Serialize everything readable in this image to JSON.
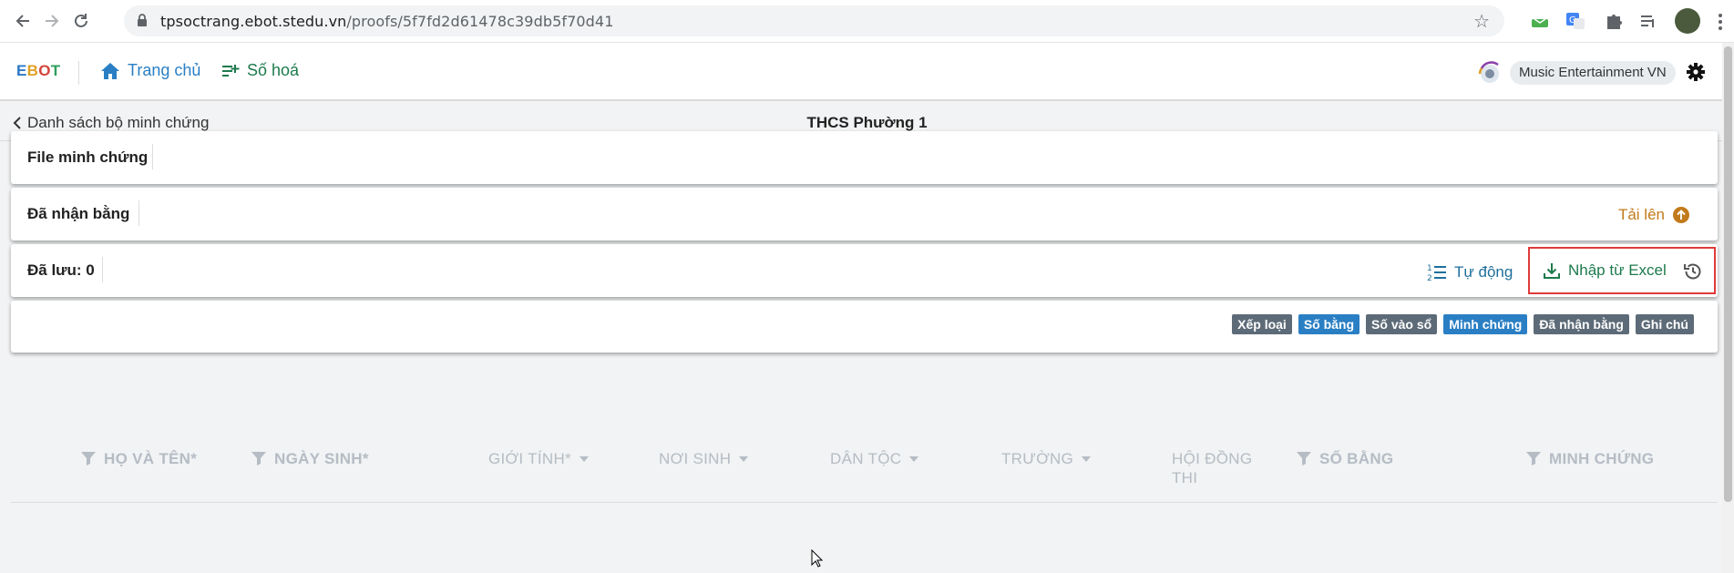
{
  "browser": {
    "url_host": "tpsoctrang.ebot.stedu.vn",
    "url_path": "/proofs/5f7fd2d61478c39db5f70d41",
    "icons": [
      "back-arrow-icon",
      "forward-arrow-icon",
      "reload-icon",
      "lock-icon",
      "star-icon",
      "extension-icons",
      "avatar"
    ]
  },
  "app": {
    "logo": [
      "E",
      "B",
      "O",
      "T"
    ],
    "nav": {
      "home": "Trang chủ",
      "digitize": "Số hoá"
    },
    "org_name": "Music Entertainment VN"
  },
  "page": {
    "back_label": "Danh sách bộ minh chứng",
    "title": "THCS Phường 1"
  },
  "cards": {
    "files_label": "File minh chứng",
    "received_label": "Đã nhận bằng",
    "upload_label": "Tải lên",
    "saved_label": "Đã lưu: 0",
    "auto_label": "Tự động",
    "excel_label": "Nhập từ Excel"
  },
  "chips": [
    {
      "label": "Xếp loại",
      "color": "gray"
    },
    {
      "label": "Số bằng",
      "color": "blue"
    },
    {
      "label": "Số vào sổ",
      "color": "gray"
    },
    {
      "label": "Minh chứng",
      "color": "blue"
    },
    {
      "label": "Đã nhận bằng",
      "color": "gray"
    },
    {
      "label": "Ghi chú",
      "color": "gray"
    }
  ],
  "table": {
    "headers": [
      "HỌ VÀ TÊN*",
      "NGÀY SINH*",
      "GIỚI TÍNH*",
      "NƠI SINH",
      "DÂN TỘC",
      "TRƯỜNG",
      "HỘI ĐỒNG THI",
      "SỐ BẰNG",
      "MINH CHỨNG"
    ],
    "hoi_dong_line1": "HỘI ĐỒNG",
    "hoi_dong_line2": "THI"
  },
  "colors": {
    "accent_blue": "#2a7fc4",
    "upload_orange": "#c27a1a",
    "excel_green": "#1d7a4c",
    "highlight_red": "#e03a3a"
  }
}
